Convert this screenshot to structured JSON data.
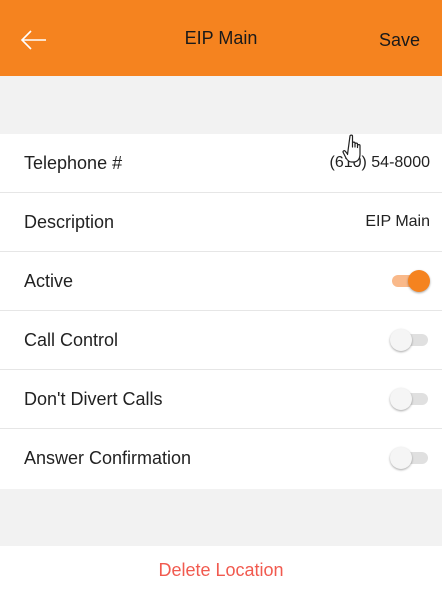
{
  "header": {
    "title": "EIP Main",
    "save_label": "Save",
    "back_icon": "arrow-left-icon",
    "color": "#f5831f"
  },
  "rows": [
    {
      "label": "Telephone #",
      "value": "(610) 54-8000"
    },
    {
      "label": "Description",
      "value": "EIP Main"
    },
    {
      "label": "Active",
      "toggle": true
    },
    {
      "label": "Call Control",
      "toggle": false
    },
    {
      "label": "Don't Divert Calls",
      "toggle": false
    },
    {
      "label": "Answer Confirmation",
      "toggle": false
    }
  ],
  "delete_label": "Delete Location",
  "colors": {
    "accent": "#f5831f",
    "delete": "#f15a4f",
    "band": "#f2f2f2"
  }
}
